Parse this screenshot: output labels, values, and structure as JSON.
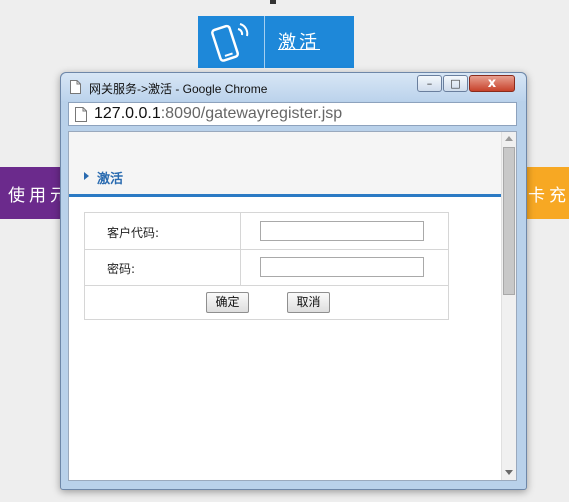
{
  "background_tiles": {
    "activate": {
      "label": "激活",
      "color": "#1e88d9"
    },
    "left": {
      "label": "使用元",
      "color": "#6b2a8c"
    },
    "right": {
      "label": "卡充",
      "color": "#f7a823"
    }
  },
  "window": {
    "title": "网关服务->激活 - Google Chrome",
    "controls": {
      "minimize": "–",
      "maximize": "□",
      "close": "x"
    },
    "address": {
      "host": "127.0.0.1",
      "rest": ":8090/gatewayregister.jsp"
    }
  },
  "page": {
    "section_title": "激活",
    "form": {
      "fields": [
        {
          "label": "客户代码:",
          "value": ""
        },
        {
          "label": "密码:",
          "value": ""
        }
      ],
      "confirm_label": "确定",
      "cancel_label": "取消"
    },
    "accent_color": "#2b7ac4"
  }
}
